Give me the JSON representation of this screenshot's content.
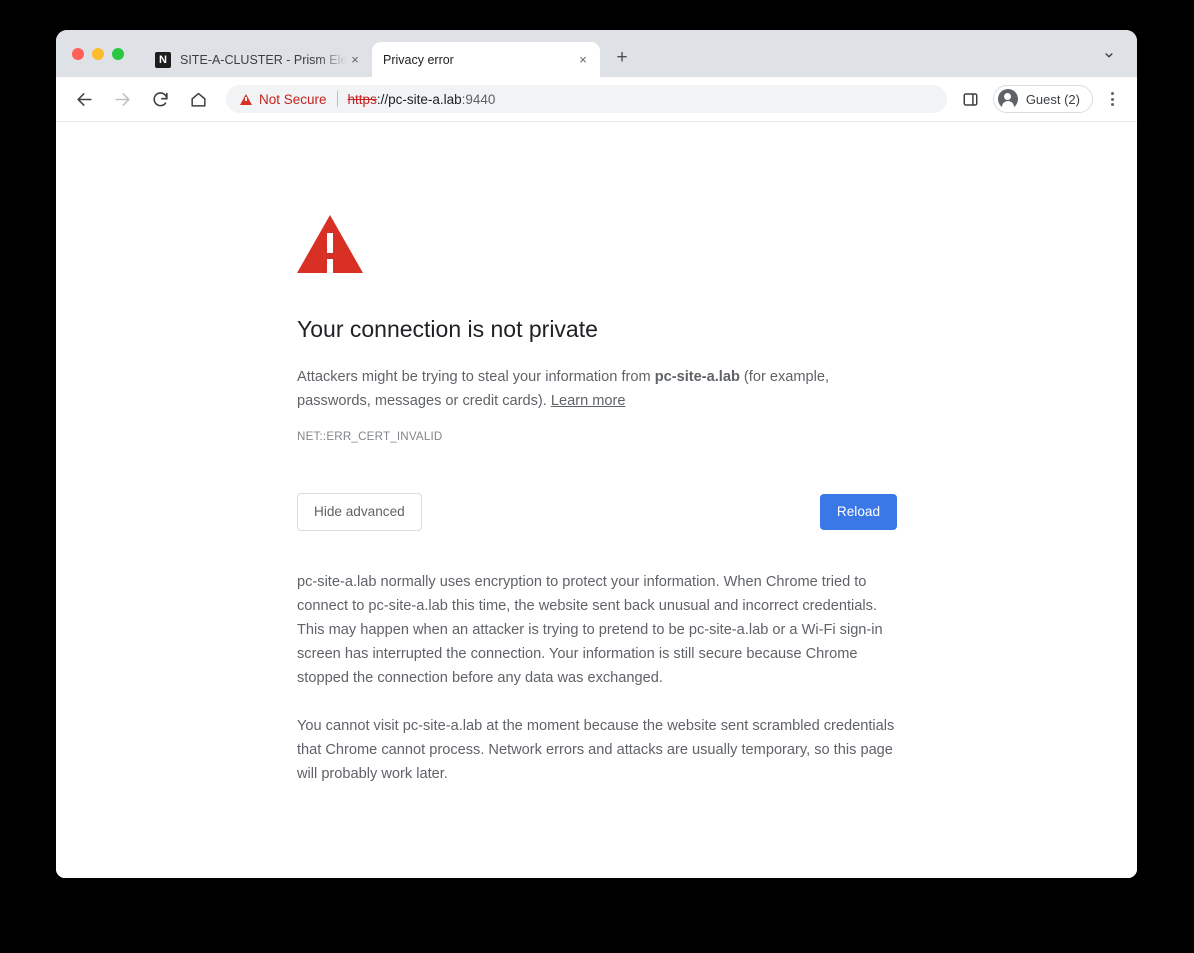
{
  "window": {
    "traffic_lights": [
      "close",
      "minimize",
      "zoom"
    ]
  },
  "tabstrip": {
    "tabs": [
      {
        "title": "SITE-A-CLUSTER - Prism Elem",
        "favicon_text": "N",
        "favicon_name": "nutanix-favicon",
        "active": false,
        "close_label": "×"
      },
      {
        "title": "Privacy error",
        "active": true,
        "close_label": "×"
      }
    ],
    "new_tab_label": "+",
    "tab_search_icon": "chevron-down-icon"
  },
  "toolbar": {
    "back_icon": "back-arrow-icon",
    "forward_icon": "forward-arrow-icon",
    "reload_icon": "reload-icon",
    "home_icon": "home-icon",
    "omnibox": {
      "security_icon": "warning-triangle-icon",
      "security_label": "Not Secure",
      "url_scheme": "https",
      "url_separator": "://",
      "url_host": "pc-site-a.lab",
      "url_port": ":9440"
    },
    "side_panel_icon": "side-panel-icon",
    "profile": {
      "avatar_icon": "person-avatar-icon",
      "label": "Guest (2)"
    },
    "menu_icon": "three-dot-menu-icon"
  },
  "page": {
    "warning_icon": "warning-triangle-icon",
    "title": "Your connection is not private",
    "lead_before": "Attackers might be trying to steal your information from ",
    "lead_host": "pc-site-a.lab",
    "lead_after": " (for example, passwords, messages or credit cards). ",
    "learn_more": "Learn more",
    "error_code": "NET::ERR_CERT_INVALID",
    "advanced_button": "Hide advanced",
    "reload_button": "Reload",
    "advanced_paragraph_1": "pc-site-a.lab normally uses encryption to protect your information. When Chrome tried to connect to pc-site-a.lab this time, the website sent back unusual and incorrect credentials. This may happen when an attacker is trying to pretend to be pc-site-a.lab or a Wi-Fi sign-in screen has interrupted the connection. Your information is still secure because Chrome stopped the connection before any data was exchanged.",
    "advanced_paragraph_2": "You cannot visit pc-site-a.lab at the moment because the website sent scrambled credentials that Chrome cannot process. Network errors and attacks are usually temporary, so this page will probably work later."
  },
  "colors": {
    "danger": "#d93025",
    "link_blue": "#3b78e7",
    "tabstrip_bg": "#dee1e6",
    "omnibox_bg": "#f1f3f4"
  }
}
